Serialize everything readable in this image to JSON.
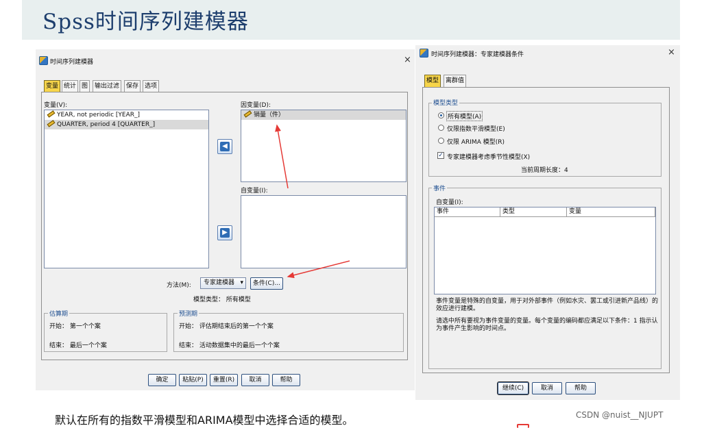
{
  "slide": {
    "title": "Spss时间序列建模器",
    "caption": "默认在所有的指数平滑模型和ARIMA模型中选择合适的模型。",
    "watermark": "CSDN @nuist__NJUPT"
  },
  "colors": {
    "title_text": "#1d3e6d",
    "title_band": "#e8efef",
    "active_tab": "#f7d54a",
    "annotation_arrow": "#e53935"
  },
  "left_dialog": {
    "title": "时间序列建模器",
    "tabs": [
      "变量",
      "统计",
      "图",
      "输出过滤",
      "保存",
      "选项"
    ],
    "active_tab": 0,
    "variables_label": "变量(V):",
    "variables": [
      "YEAR, not periodic [YEAR_]",
      "QUARTER, period 4 [QUARTER_]"
    ],
    "dependent_label": "因变量(D):",
    "dependent_items": [
      "销量（件）"
    ],
    "independent_label": "自变量(I):",
    "method_label": "方法(M):",
    "method_value": "专家建模器",
    "criteria_button": "条件(C)...",
    "model_type_text": "模型类型：  所有模型",
    "estimation": {
      "legend": "估算期",
      "start_text": "开始：  第一个个案",
      "end_text": "结束：  最后一个个案"
    },
    "forecast": {
      "legend": "预测期",
      "start_text": "开始：  评估期结束后的第一个个案",
      "end_text": "结束：  活动数据集中的最后一个个案"
    },
    "buttons": [
      "确定",
      "粘贴(P)",
      "重置(R)",
      "取消",
      "帮助"
    ]
  },
  "right_dialog": {
    "title": "时间序列建模器：专家建模器条件",
    "tabs": [
      "模型",
      "离群值"
    ],
    "active_tab": 0,
    "model_type_legend": "模型类型",
    "radios": [
      {
        "label": "所有模型(A)",
        "checked": true
      },
      {
        "label": "仅限指数平滑模型(E)",
        "checked": false
      },
      {
        "label": "仅限 ARIMA 模型(R)",
        "checked": false
      }
    ],
    "seasonal_checkbox": {
      "label": "专家建模器考虑季节性模型(X)",
      "checked": true
    },
    "current_period_text": "当前周期长度：4",
    "events_legend": "事件",
    "independent_label": "自变量(I):",
    "grid_headers": [
      "事件",
      "类型",
      "变量"
    ],
    "desc_1": "事件变量是特殊的自变量，用于对外部事件（例如水灾、罢工或引进新产品线）的效应进行建模。",
    "desc_2": "请选中所有要视为事件变量的变量。每个变量的编码都应满足以下条件：1 指示认为事件产生影响的时间点。",
    "buttons": [
      "继续(C)",
      "取消",
      "帮助"
    ]
  }
}
